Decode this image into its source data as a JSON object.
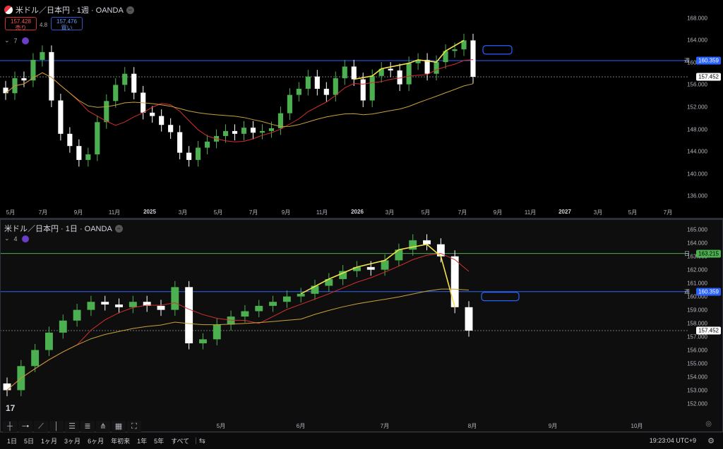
{
  "top": {
    "title": "米ドル／日本円 · 1週 · OANDA",
    "sell_price": "157.428",
    "sell_label": "売り",
    "spread": "4.8",
    "buy_price": "157.476",
    "buy_label": "買い",
    "indicator_count": "7",
    "y_ticks": [
      "168.000",
      "164.000",
      "160.000",
      "156.000",
      "152.000",
      "148.000",
      "144.000",
      "140.000",
      "136.000"
    ],
    "x_ticks": [
      "5月",
      "7月",
      "9月",
      "11月",
      "2025",
      "3月",
      "5月",
      "7月",
      "9月",
      "11月",
      "2026",
      "3月",
      "5月",
      "7月",
      "9月",
      "11月",
      "2027",
      "3月",
      "5月",
      "7月"
    ],
    "tags": [
      {
        "name": "週",
        "value": "160.359",
        "color": "#2962ff",
        "text": "#fff"
      },
      {
        "name": "",
        "value": "157.452",
        "color": "#ffffff",
        "text": "#000"
      }
    ]
  },
  "bottom": {
    "title": "米ドル／日本円 · 1日 · OANDA",
    "indicator_count": "4",
    "y_ticks": [
      "165.000",
      "164.000",
      "163.000",
      "162.000",
      "161.000",
      "160.000",
      "159.000",
      "158.000",
      "157.000",
      "156.000",
      "155.000",
      "154.000",
      "153.000",
      "152.000"
    ],
    "x_ticks": [
      "5月",
      "6月",
      "7月",
      "8月",
      "9月",
      "10月"
    ],
    "tags": [
      {
        "name": "日",
        "value": "163.215",
        "color": "#4caf50",
        "text": "#000"
      },
      {
        "name": "週",
        "value": "160.359",
        "color": "#2962ff",
        "text": "#fff"
      },
      {
        "name": "",
        "value": "157.452",
        "color": "#ffffff",
        "text": "#000"
      }
    ]
  },
  "bottom_bar": {
    "timeframes": [
      "1日",
      "5日",
      "1ヶ月",
      "3ヶ月",
      "6ヶ月",
      "年初来",
      "1年",
      "5年",
      "すべて"
    ],
    "clock": "19:23:04 UTC+9"
  },
  "drawing_tools": [
    "cursor",
    "trend-line",
    "fib",
    "channel",
    "pitchfork",
    "rectangle",
    "brush",
    "measure"
  ],
  "colors": {
    "bull": "#4caf50",
    "bear": "#ffffff",
    "ma_short": "#d32f2f",
    "ma_long": "#c8a23a",
    "pattern": "#f5e14a",
    "weekly_line": "#2962ff",
    "daily_line": "#4caf50"
  },
  "chart_data": [
    {
      "type": "candlestick",
      "title": "米ドル／日本円 · 1週 · OANDA",
      "ylim": [
        134.5,
        170
      ],
      "x_range": [
        "2024-04",
        "2027-08"
      ],
      "series": [
        {
          "name": "close",
          "values": [
            154.5,
            157.2,
            156.8,
            160.5,
            161.9,
            153.2,
            147.2,
            145.0,
            142.5,
            143.5,
            149.3,
            153.1,
            156.0,
            158.0,
            154.6,
            151.0,
            150.4,
            148.8,
            147.5,
            143.8,
            142.5,
            144.7,
            145.8,
            146.8,
            147.7,
            147.2,
            148.3,
            147.4,
            147.7,
            148.2,
            150.9,
            154.2,
            155.3,
            157.5,
            155.3,
            154.2,
            157.2,
            159.3,
            157.0,
            153.2,
            157.6,
            158.9,
            158.6,
            156.1,
            159.9,
            160.5,
            158.0,
            160.1,
            162.1,
            162.4,
            164.0,
            157.45
          ]
        }
      ],
      "reference_lines": [
        {
          "name": "週",
          "value": 160.359
        },
        {
          "name": "current",
          "value": 157.452
        }
      ]
    },
    {
      "type": "candlestick",
      "title": "米ドル／日本円 · 1日 · OANDA",
      "ylim": [
        151.5,
        165.3
      ],
      "x_range": [
        "2026-04",
        "2026-10"
      ],
      "series": [
        {
          "name": "close",
          "values": [
            153.0,
            154.8,
            156.0,
            157.3,
            158.2,
            159.0,
            159.6,
            159.4,
            159.2,
            159.6,
            159.3,
            159.0,
            160.7,
            156.5,
            156.8,
            157.9,
            158.5,
            158.9,
            159.3,
            159.6,
            160.0,
            160.2,
            160.8,
            161.3,
            161.9,
            162.2,
            162.0,
            162.7,
            163.5,
            164.2,
            163.9,
            163.0,
            159.2,
            157.45
          ]
        }
      ],
      "reference_lines": [
        {
          "name": "日",
          "value": 163.215
        },
        {
          "name": "週",
          "value": 160.359
        },
        {
          "name": "current",
          "value": 157.452
        }
      ]
    }
  ]
}
